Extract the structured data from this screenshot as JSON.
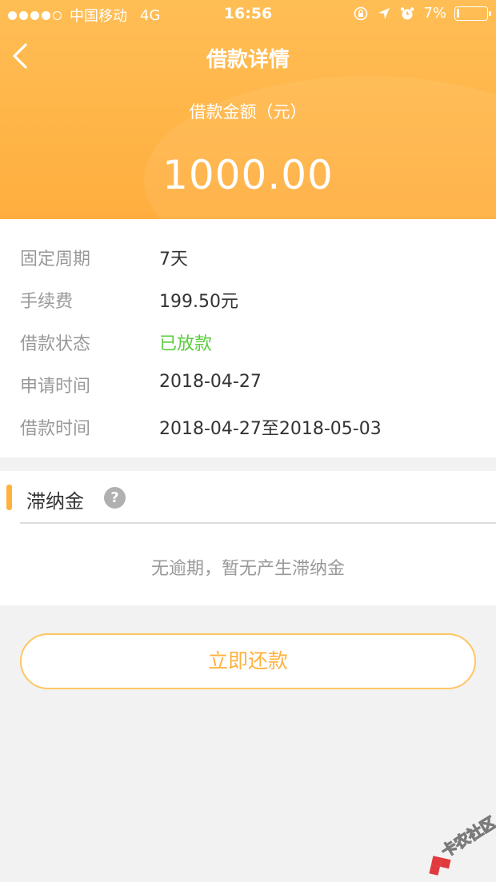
{
  "status_bar": {
    "carrier": "中国移动",
    "network": "4G",
    "time": "16:56",
    "battery": "7%",
    "battery_level": 0.07,
    "icons": [
      "orientation-lock-icon",
      "location-icon",
      "alarm-icon"
    ]
  },
  "nav": {
    "title": "借款详情",
    "back_icon": "chevron-left-icon"
  },
  "loan": {
    "amount_label": "借款金额（元）",
    "amount": "1000.00"
  },
  "details": [
    {
      "label": "固定周期",
      "value": "7天"
    },
    {
      "label": "手续费",
      "value": "199.50元"
    },
    {
      "label": "借款状态",
      "value": "已放款"
    },
    {
      "label": "申请时间",
      "value": "2018-04-27"
    },
    {
      "label": "借款时间",
      "value": "2018-04-27至2018-05-03"
    }
  ],
  "late_fee": {
    "title": "滞纳金",
    "help_icon": "question-icon",
    "help_glyph": "?",
    "empty_text": "无逾期，暂无产生滞纳金"
  },
  "actions": {
    "repay_label": "立即还款"
  },
  "watermark": {
    "text": "卡农社区"
  },
  "colors": {
    "header": "#ffb548",
    "accent": "#ffb23c",
    "status_green": "#5bcc3e",
    "label_gray": "#999999",
    "value_dark": "#333333",
    "background": "#f2f2f2"
  }
}
